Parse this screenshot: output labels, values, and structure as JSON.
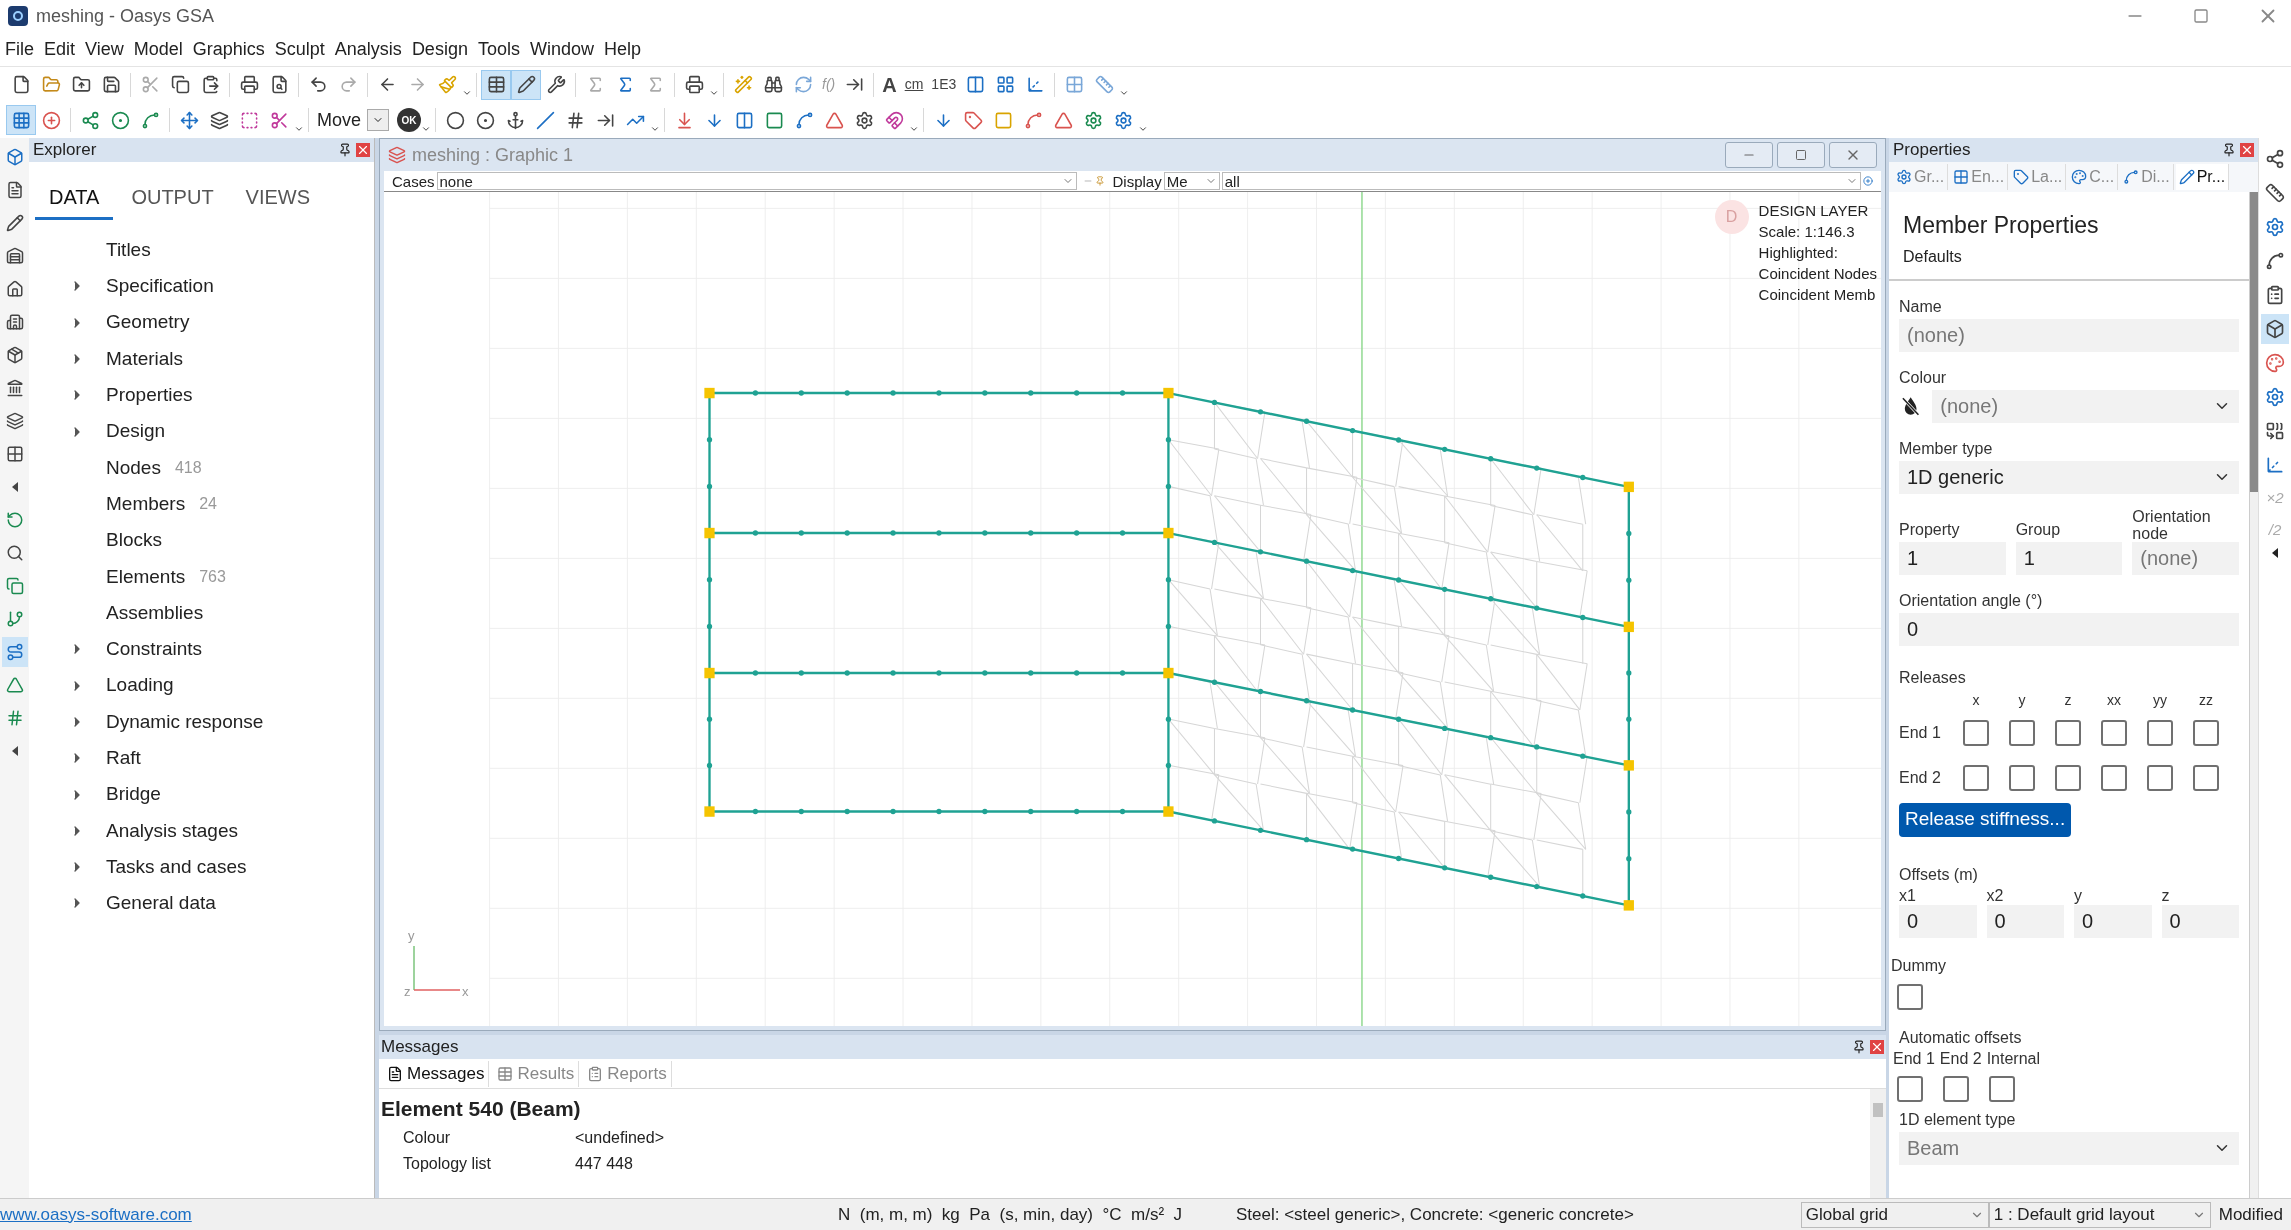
{
  "window": {
    "title": "meshing - Oasys GSA"
  },
  "menu": [
    "File",
    "Edit",
    "View",
    "Model",
    "Graphics",
    "Sculpt",
    "Analysis",
    "Design",
    "Tools",
    "Window",
    "Help"
  ],
  "toolbar": {
    "table_view_on": true,
    "sketch_on": true,
    "snap_grid_on": true,
    "glyphs": [
      "f()",
      "A",
      "cm",
      "1E3"
    ],
    "mode_select": "Move",
    "ok_glyph": "OK"
  },
  "tool_strip": {
    "member_tool_on": true
  },
  "explorer": {
    "title": "Explorer",
    "tabs": [
      {
        "label": "DATA",
        "selected": true
      },
      {
        "label": "OUTPUT",
        "selected": false
      },
      {
        "label": "VIEWS",
        "selected": false
      }
    ],
    "items": [
      {
        "kind": "leaf",
        "label": "Titles"
      },
      {
        "kind": "folder",
        "label": "Specification",
        "expanded": false
      },
      {
        "kind": "folder",
        "label": "Geometry",
        "expanded": false
      },
      {
        "kind": "folder",
        "label": "Materials",
        "expanded": false
      },
      {
        "kind": "folder",
        "label": "Properties",
        "expanded": false
      },
      {
        "kind": "folder",
        "label": "Design",
        "expanded": false
      },
      {
        "kind": "leaf",
        "label": "Nodes",
        "count": "418"
      },
      {
        "kind": "leaf",
        "label": "Members",
        "count": "24"
      },
      {
        "kind": "leaf",
        "label": "Blocks"
      },
      {
        "kind": "leaf",
        "label": "Elements",
        "count": "763"
      },
      {
        "kind": "leaf",
        "label": "Assemblies"
      },
      {
        "kind": "folder",
        "label": "Constraints",
        "expanded": false
      },
      {
        "kind": "folder",
        "label": "Loading",
        "expanded": false
      },
      {
        "kind": "folder",
        "label": "Dynamic response",
        "expanded": false
      },
      {
        "kind": "folder",
        "label": "Raft",
        "expanded": false
      },
      {
        "kind": "folder",
        "label": "Bridge",
        "expanded": false
      },
      {
        "kind": "folder",
        "label": "Analysis stages",
        "expanded": false
      },
      {
        "kind": "folder",
        "label": "Tasks and cases",
        "expanded": false
      },
      {
        "kind": "folder",
        "label": "General data",
        "expanded": false
      }
    ]
  },
  "graphic": {
    "title": "meshing : Graphic 1",
    "cases_label": "Cases",
    "cases_value": "none",
    "display_label": "Display",
    "display_value": "Me",
    "display_filter": "all",
    "layer_badge": "D",
    "info": [
      "DESIGN LAYER",
      "Scale: 1:146.3",
      "Highlighted:",
      "Coincident Nodes",
      "Coincident Memb"
    ],
    "axes": [
      "y",
      "z",
      "x"
    ]
  },
  "properties": {
    "title": "Properties",
    "tabs": [
      {
        "label": "Gr...",
        "selected": false
      },
      {
        "label": "En...",
        "selected": false
      },
      {
        "label": "La...",
        "selected": false
      },
      {
        "label": "C...",
        "selected": false
      },
      {
        "label": "Di...",
        "selected": false
      },
      {
        "label": "Pr...",
        "selected": true
      }
    ],
    "heading": "Member Properties",
    "subheading": "Defaults",
    "name": {
      "label": "Name",
      "placeholder": "(none)"
    },
    "colour": {
      "label": "Colour",
      "placeholder": "(none)"
    },
    "member_type": {
      "label": "Member type",
      "value": "1D generic"
    },
    "property": {
      "label": "Property",
      "value": "1"
    },
    "group": {
      "label": "Group",
      "value": "1"
    },
    "orientation_node": {
      "label": "Orientation node",
      "placeholder": "(none)"
    },
    "orientation_angle": {
      "label": "Orientation angle (°)",
      "value": "0"
    },
    "releases": {
      "label": "Releases",
      "columns": [
        "x",
        "y",
        "z",
        "xx",
        "yy",
        "zz"
      ],
      "rows": [
        {
          "label": "End 1",
          "checked": [
            false,
            false,
            false,
            false,
            false,
            false
          ]
        },
        {
          "label": "End 2",
          "checked": [
            false,
            false,
            false,
            false,
            false,
            false
          ]
        }
      ]
    },
    "release_button": "Release stiffness...",
    "offsets": {
      "label": "Offsets (m)",
      "fields": [
        {
          "label": "x1",
          "value": "0"
        },
        {
          "label": "x2",
          "value": "0"
        },
        {
          "label": "y",
          "value": "0"
        },
        {
          "label": "z",
          "value": "0"
        }
      ]
    },
    "dummy": {
      "label": "Dummy",
      "checked": false
    },
    "auto_offsets": {
      "label": "Automatic offsets",
      "items": [
        {
          "label": "End 1",
          "checked": false
        },
        {
          "label": "End 2",
          "checked": false
        },
        {
          "label": "Internal",
          "checked": false
        }
      ]
    },
    "element_type": {
      "label": "1D element type",
      "value": "Beam"
    }
  },
  "side_strip": {
    "cube_on": true,
    "glyphs": [
      "×2",
      "/2"
    ]
  },
  "messages": {
    "title": "Messages",
    "tabs": [
      {
        "label": "Messages",
        "selected": true
      },
      {
        "label": "Results",
        "selected": false
      },
      {
        "label": "Reports",
        "selected": false
      }
    ],
    "heading": "Element 540 (Beam)",
    "rows": [
      {
        "key": "Colour",
        "value": "<undefined>"
      },
      {
        "key": "Topology list",
        "value": "447 448"
      }
    ]
  },
  "status_bar": {
    "link": "www.oasys-software.com",
    "units": "N  (m, m, m)  kg  Pa  (s, min, day)  °C  m/s²  J",
    "materials": "Steel: <steel generic>, Concrete: <generic concrete>",
    "grid": "Global grid",
    "layout": "1 : Default grid layout",
    "state": "Modified"
  }
}
